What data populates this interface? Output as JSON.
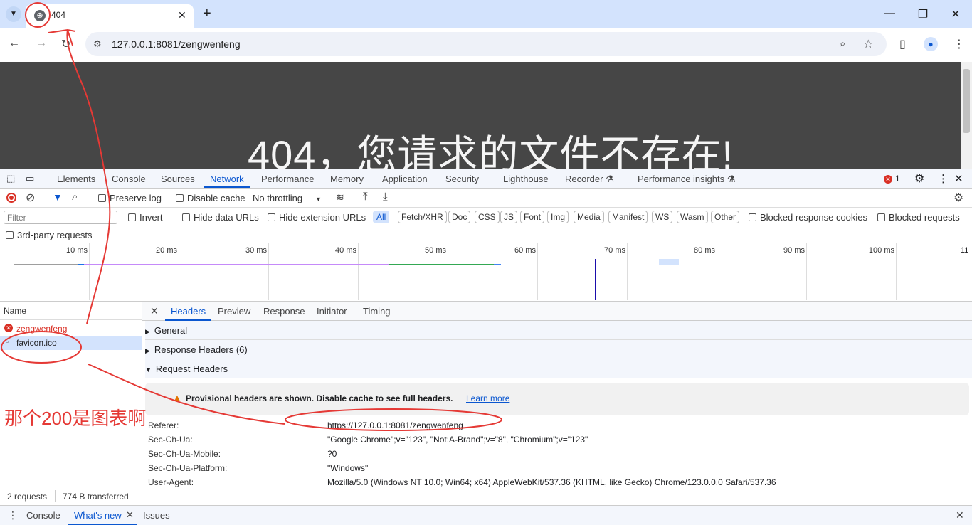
{
  "browser": {
    "tab_title": "404",
    "new_tab": "+",
    "url": "127.0.0.1:8081/zengwenfeng",
    "minimize": "—",
    "restore": "❐",
    "close": "✕"
  },
  "page": {
    "heading": "404，您请求的文件不存在!"
  },
  "devtools": {
    "tabs": [
      "Elements",
      "Console",
      "Sources",
      "Network",
      "Performance",
      "Memory",
      "Application",
      "Security",
      "Lighthouse",
      "Recorder ⚗",
      "Performance insights ⚗"
    ],
    "error_count": "1",
    "toolbar": {
      "preserve_log": "Preserve log",
      "disable_cache": "Disable cache",
      "throttling": "No throttling"
    },
    "filter": {
      "placeholder": "Filter",
      "invert": "Invert",
      "hide_data_urls": "Hide data URLs",
      "hide_ext_urls": "Hide extension URLs",
      "types": [
        "All",
        "Fetch/XHR",
        "Doc",
        "CSS",
        "JS",
        "Font",
        "Img",
        "Media",
        "Manifest",
        "WS",
        "Wasm",
        "Other"
      ],
      "blocked_cookies": "Blocked response cookies",
      "blocked_requests": "Blocked requests",
      "third_party": "3rd-party requests"
    },
    "timeline_ticks": [
      "10 ms",
      "20 ms",
      "30 ms",
      "40 ms",
      "50 ms",
      "60 ms",
      "70 ms",
      "80 ms",
      "90 ms",
      "100 ms",
      "11"
    ],
    "requests": {
      "header": "Name",
      "items": [
        "zengwenfeng",
        "favicon.ico"
      ],
      "summary_count": "2 requests",
      "summary_size": "774 B transferred"
    },
    "detail": {
      "close": "✕",
      "tabs": [
        "Headers",
        "Preview",
        "Response",
        "Initiator",
        "Timing"
      ],
      "sections": {
        "general": "General",
        "response_headers": "Response Headers (6)",
        "request_headers": "Request Headers"
      },
      "provisional_text": "Provisional headers are shown. Disable cache to see full headers.",
      "learn_more": "Learn more",
      "headers": [
        {
          "key": "Referer:",
          "value": "https://127.0.0.1:8081/zengwenfeng"
        },
        {
          "key": "Sec-Ch-Ua:",
          "value": "\"Google Chrome\";v=\"123\", \"Not:A-Brand\";v=\"8\", \"Chromium\";v=\"123\""
        },
        {
          "key": "Sec-Ch-Ua-Mobile:",
          "value": "?0"
        },
        {
          "key": "Sec-Ch-Ua-Platform:",
          "value": "\"Windows\""
        },
        {
          "key": "User-Agent:",
          "value": "Mozilla/5.0 (Windows NT 10.0; Win64; x64) AppleWebKit/537.36 (KHTML, like Gecko) Chrome/123.0.0.0 Safari/537.36"
        }
      ]
    },
    "drawer": {
      "tabs": [
        "Console",
        "What's new",
        "Issues"
      ]
    }
  },
  "annotation": {
    "text": "那个200是图表啊",
    "color": "#e53935"
  },
  "colors": {
    "accent": "#0b57d0",
    "error": "#d93025",
    "annotation": "#e53935"
  }
}
